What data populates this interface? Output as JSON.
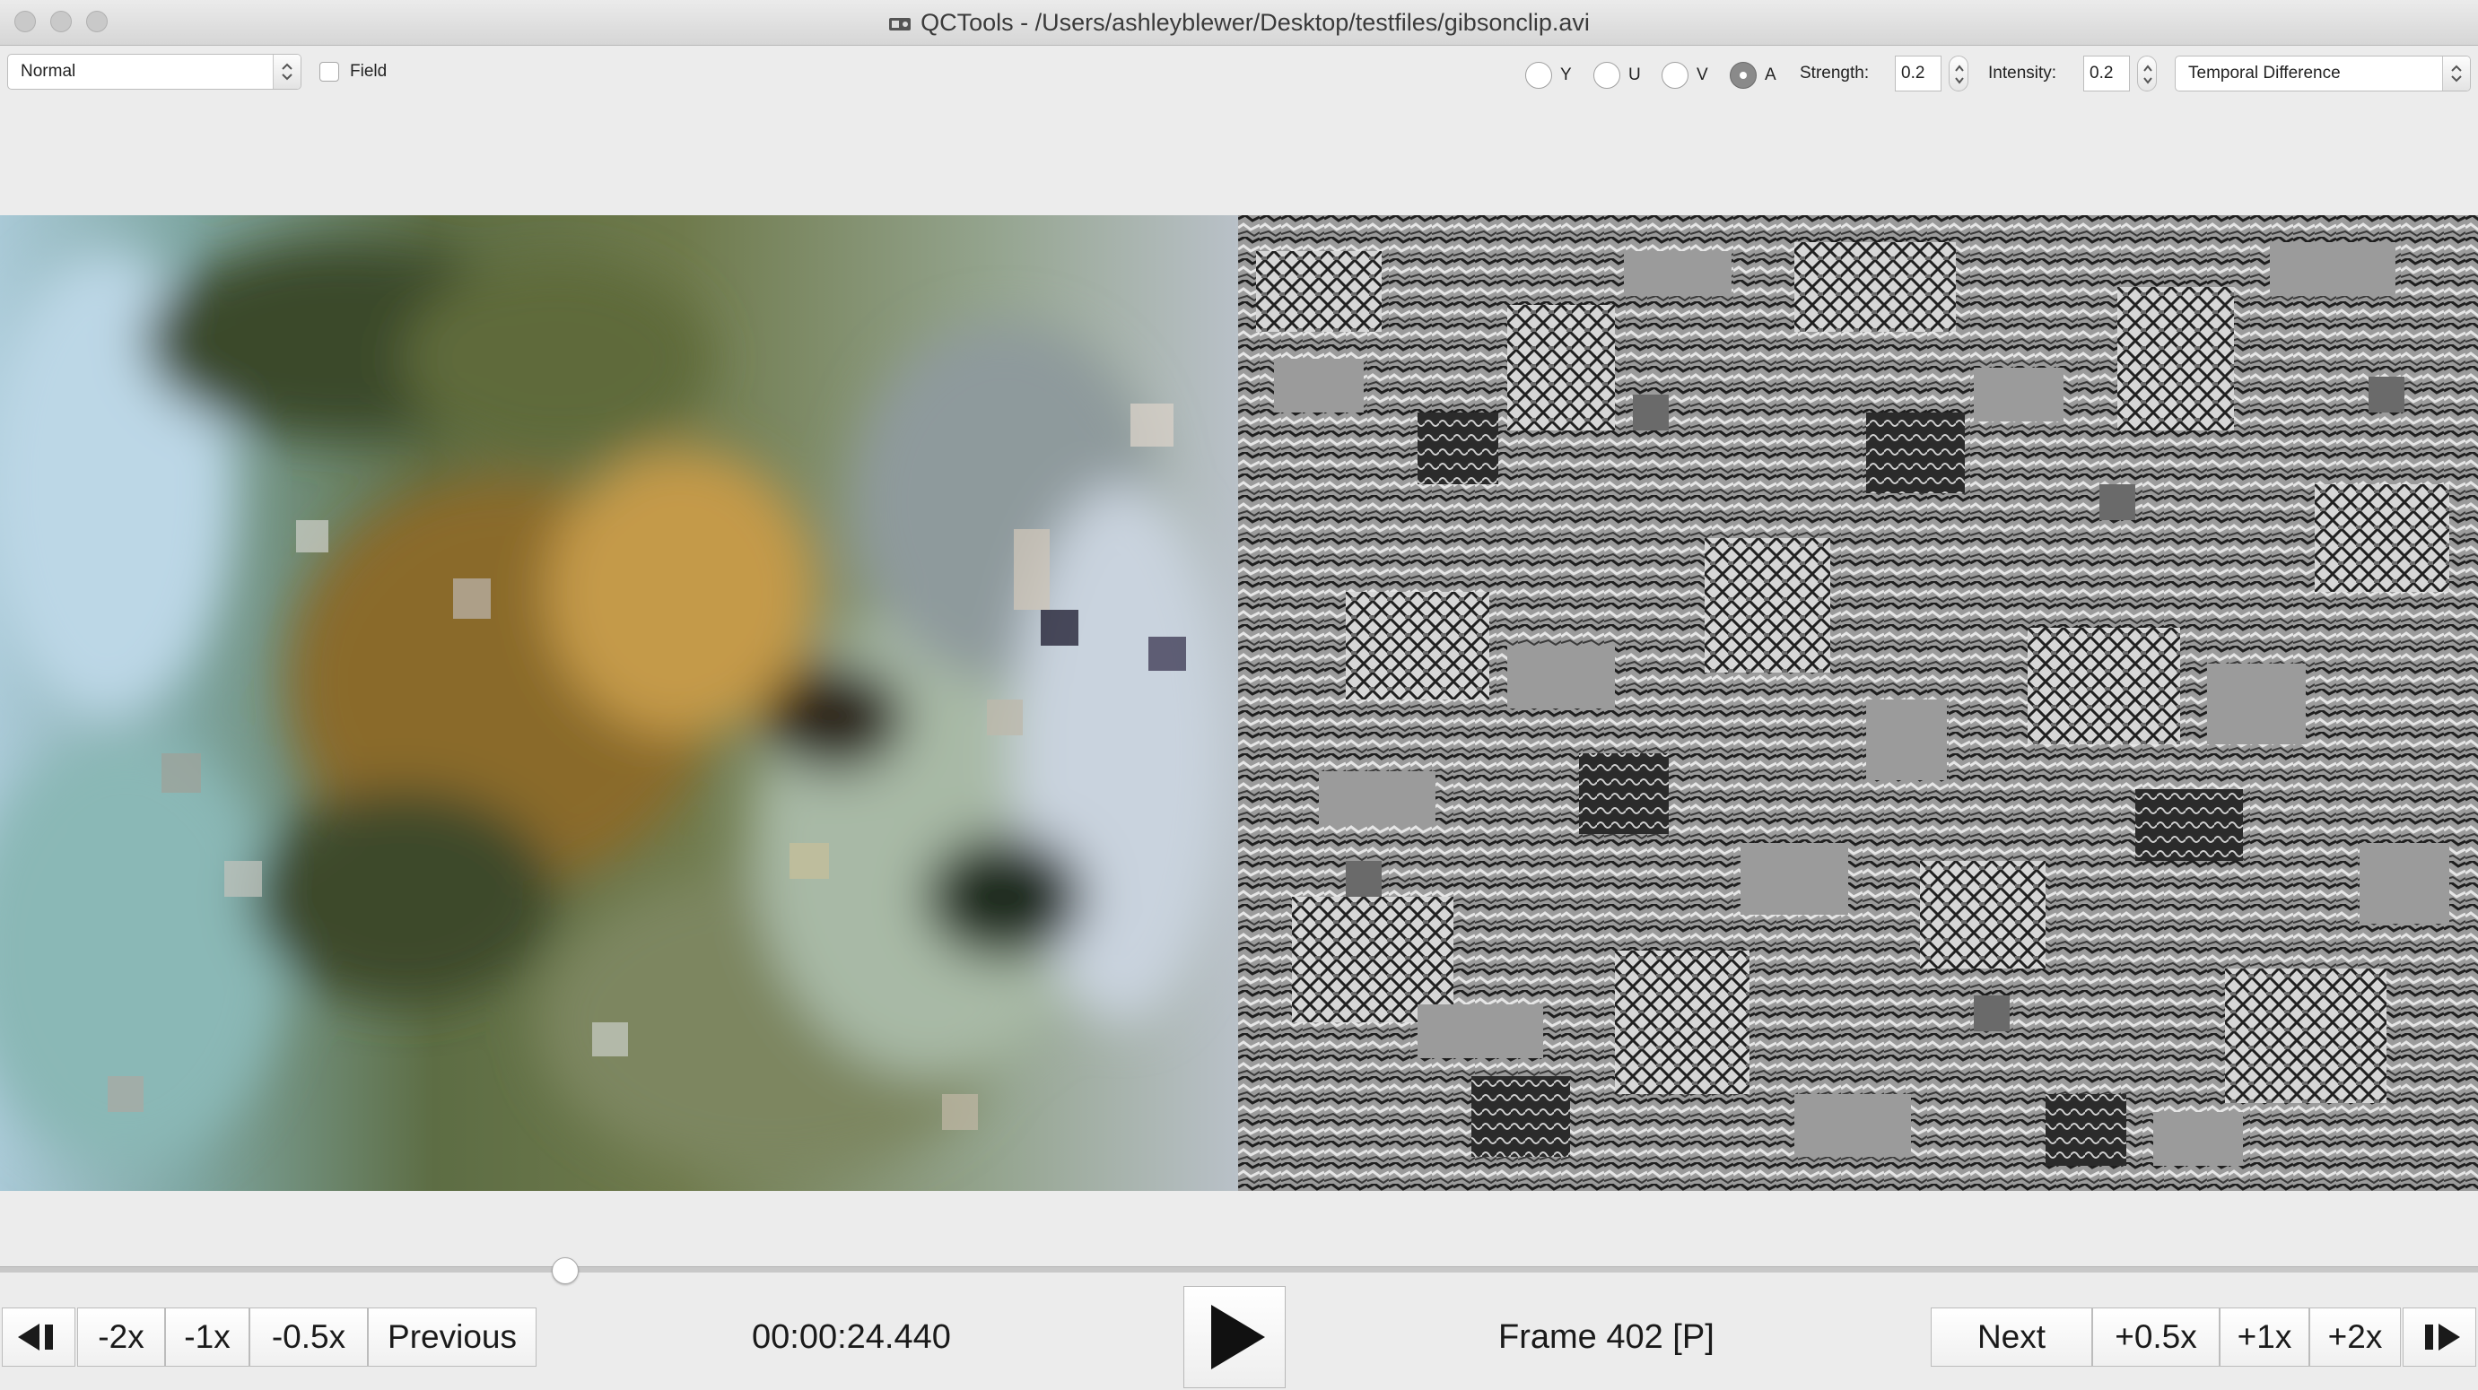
{
  "window": {
    "title": "QCTools - /Users/ashleyblewer/Desktop/testfiles/gibsonclip.avi"
  },
  "toolbar": {
    "view_mode": "Normal",
    "field_label": "Field",
    "field_checked": false,
    "plane_options": [
      {
        "label": "Y",
        "selected": false
      },
      {
        "label": "U",
        "selected": false
      },
      {
        "label": "V",
        "selected": false
      },
      {
        "label": "A",
        "selected": true
      }
    ],
    "strength_label": "Strength:",
    "strength_value": "0.2",
    "intensity_label": "Intensity:",
    "intensity_value": "0.2",
    "filter": "Temporal Difference"
  },
  "playback": {
    "position_fraction": 0.228,
    "timecode": "00:00:24.440",
    "frame": "Frame 402 [P]",
    "left_buttons": [
      "-2x",
      "-1x",
      "-0.5x",
      "Previous"
    ],
    "right_buttons": [
      "Next",
      "+0.5x",
      "+1x",
      "+2x"
    ]
  },
  "icons": {
    "step_back": "step-back-icon",
    "play": "play-icon",
    "step_forward": "step-forward-icon"
  }
}
